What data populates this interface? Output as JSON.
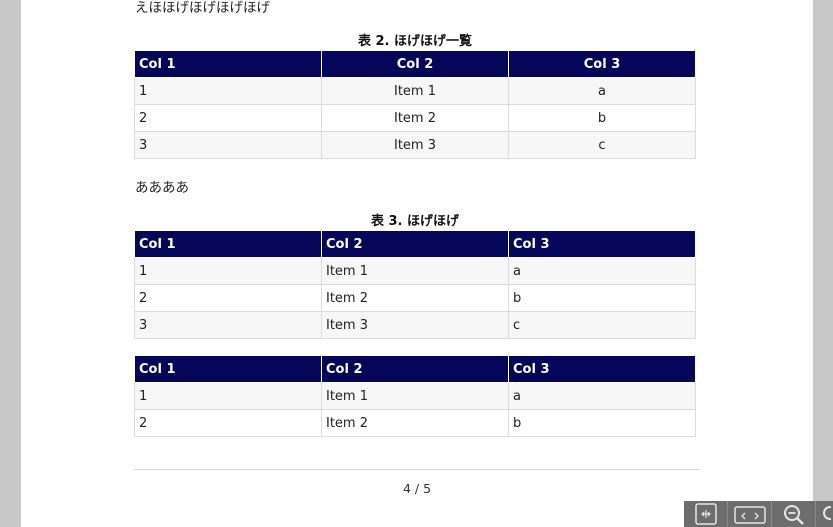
{
  "doc": {
    "top_text": "えほほげほげほげほげ",
    "table2": {
      "caption": "表 2. ほげほげ一覧",
      "headers": [
        "Col 1",
        "Col 2",
        "Col 3"
      ],
      "rows": [
        [
          "1",
          "Item 1",
          "a"
        ],
        [
          "2",
          "Item 2",
          "b"
        ],
        [
          "3",
          "Item 3",
          "c"
        ]
      ]
    },
    "mid_text": "ああああ",
    "table3": {
      "caption": "表 3. ほげほげ",
      "headers": [
        "Col 1",
        "Col 2",
        "Col 3"
      ],
      "rows": [
        [
          "1",
          "Item 1",
          "a"
        ],
        [
          "2",
          "Item 2",
          "b"
        ],
        [
          "3",
          "Item 3",
          "c"
        ]
      ]
    },
    "table4": {
      "headers": [
        "Col 1",
        "Col 2",
        "Col 3"
      ],
      "rows": [
        [
          "1",
          "Item 1",
          "a"
        ],
        [
          "2",
          "Item 2",
          "b"
        ]
      ]
    },
    "page_number": "4 / 5"
  },
  "toolbar": {
    "buttons": [
      {
        "icon": "fit-page-icon"
      },
      {
        "icon": "fit-width-icon"
      },
      {
        "icon": "zoom-icon"
      }
    ]
  },
  "colors": {
    "header_bg": "#05055a",
    "header_text": "#ffffff",
    "stripe": "#f7f7f7"
  }
}
